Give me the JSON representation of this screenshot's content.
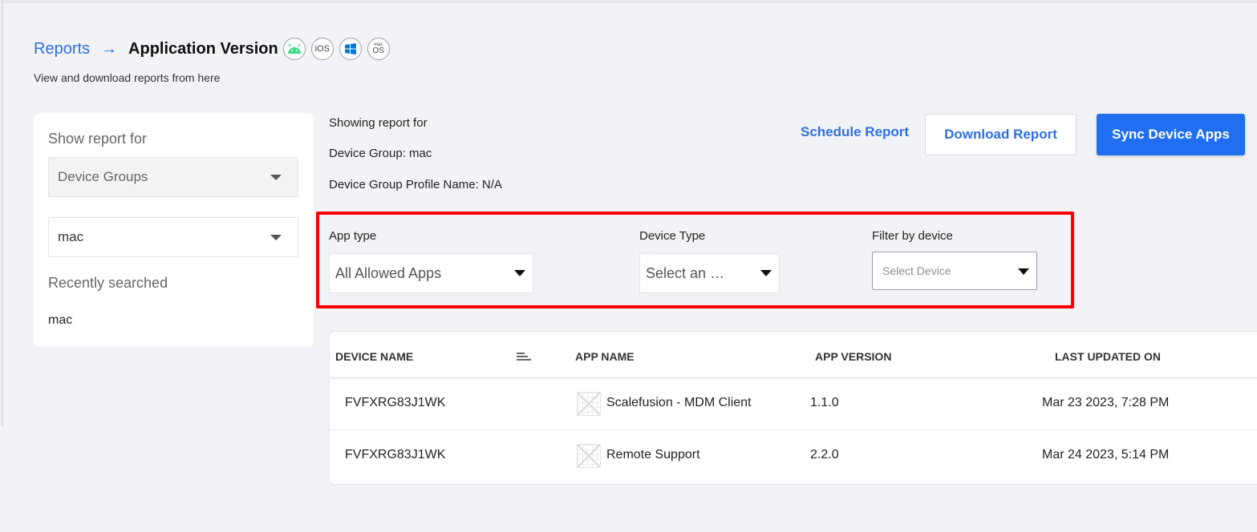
{
  "breadcrumb": {
    "parent": "Reports",
    "separator": "→",
    "current": "Application Version",
    "platform_icons": [
      {
        "name": "android-icon",
        "label": ""
      },
      {
        "name": "ios-icon",
        "label": "iOS"
      },
      {
        "name": "windows-icon",
        "label": ""
      },
      {
        "name": "macos-icon",
        "label": "OS",
        "sub": "mac"
      }
    ]
  },
  "subtitle": "View and download reports from here",
  "sidebar": {
    "title": "Show report for",
    "group_type_select": "Device Groups",
    "group_select": "mac",
    "recent_title": "Recently searched",
    "recent_items": [
      "mac"
    ]
  },
  "report_info": {
    "heading": "Showing report for",
    "device_group": "Device Group: mac",
    "profile_name": "Device Group Profile Name: N/A"
  },
  "actions": {
    "schedule": "Schedule Report",
    "download": "Download Report",
    "sync": "Sync Device Apps"
  },
  "filters": {
    "app_type": {
      "label": "App type",
      "value": "All Allowed Apps"
    },
    "device_type": {
      "label": "Device Type",
      "value": "Select an …"
    },
    "device": {
      "label": "Filter by device",
      "placeholder": "Select Device"
    }
  },
  "table": {
    "columns": [
      "DEVICE NAME",
      "APP NAME",
      "APP VERSION",
      "LAST UPDATED ON"
    ],
    "rows": [
      {
        "device": "FVFXRG83J1WK",
        "app": "Scalefusion - MDM Client",
        "version": "1.1.0",
        "updated": "Mar 23 2023, 7:28 PM"
      },
      {
        "device": "FVFXRG83J1WK",
        "app": "Remote Support",
        "version": "2.2.0",
        "updated": "Mar 24 2023, 5:14 PM"
      }
    ]
  },
  "colors": {
    "accent": "#2e6fe6",
    "primary_button": "#1f6ff0",
    "highlight_border": "#ff0000",
    "android": "#3ddc84",
    "windows": "#0078d4"
  }
}
